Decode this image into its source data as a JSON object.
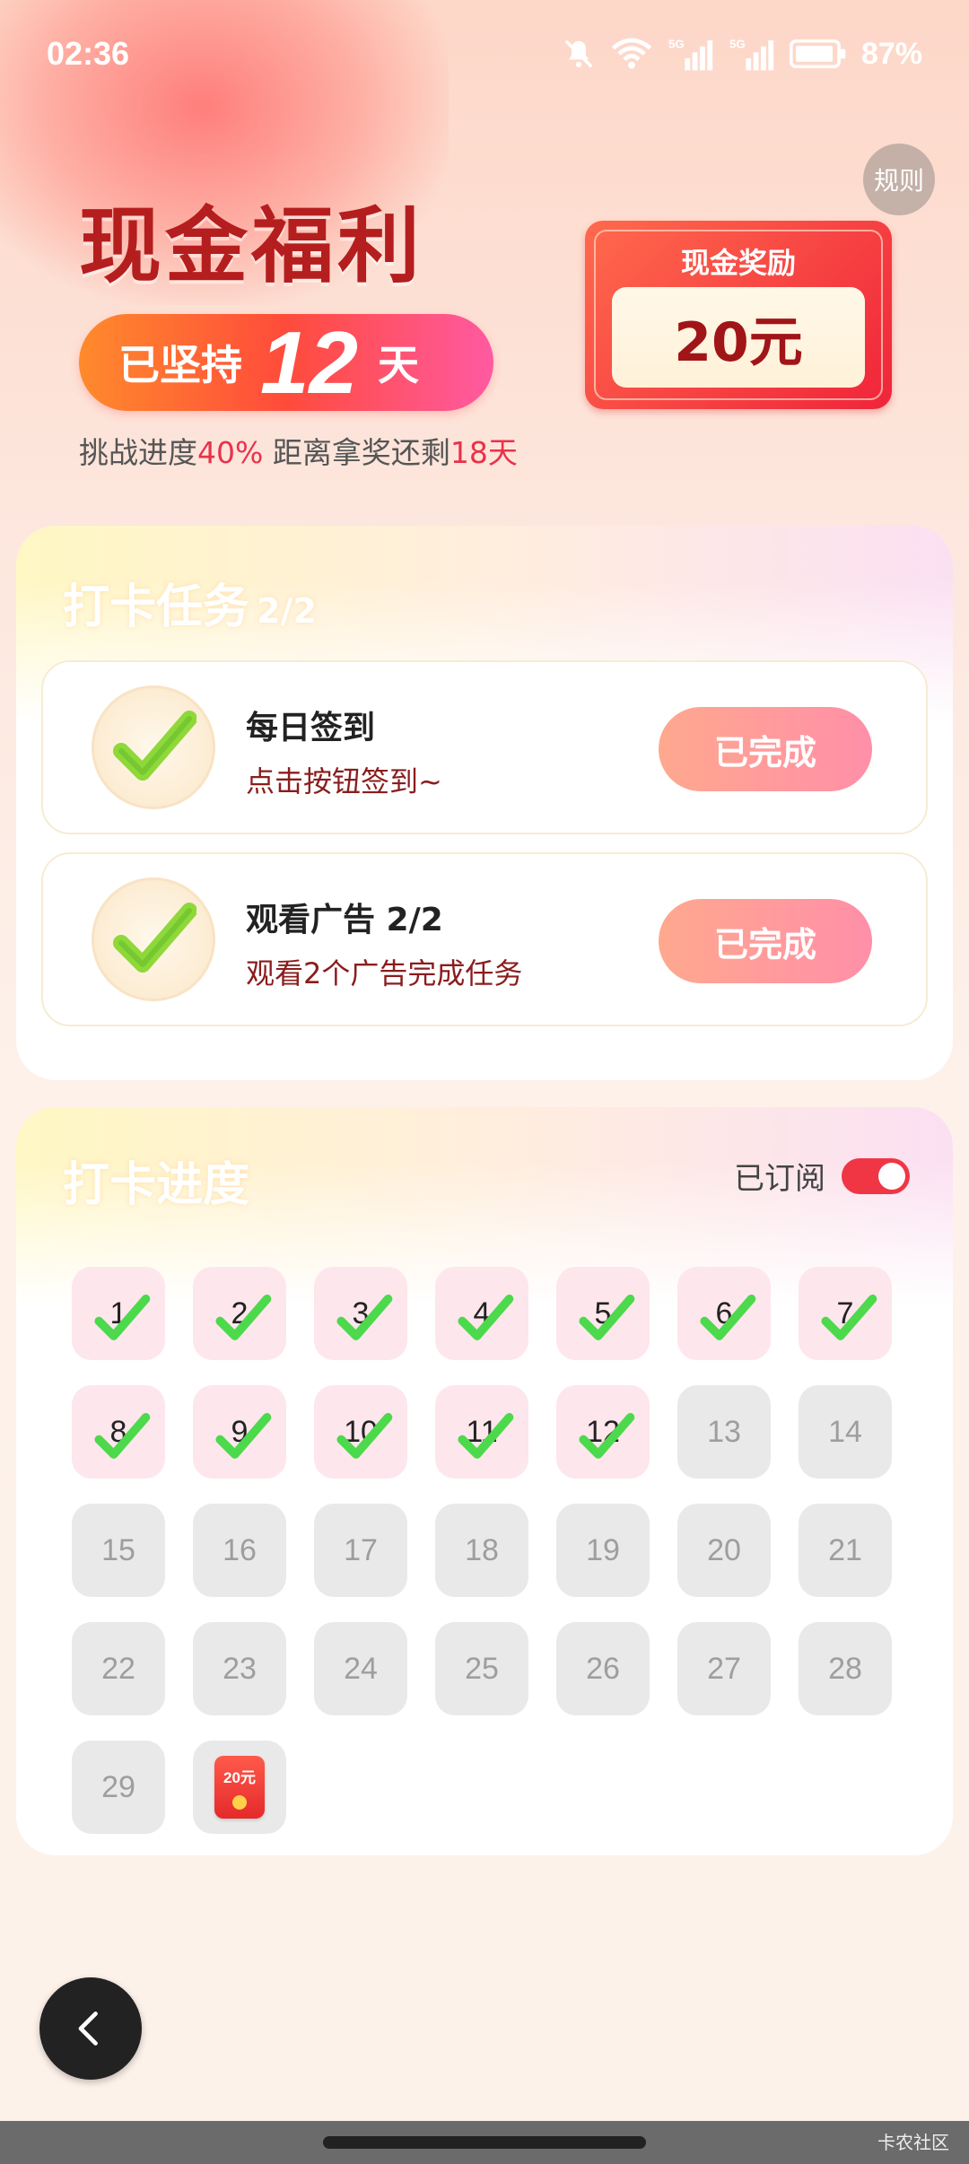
{
  "status_bar": {
    "time": "02:36",
    "battery": "87%",
    "icons": [
      "bell-mute-icon",
      "wifi-icon",
      "signal-5g-icon",
      "signal-5g-icon",
      "battery-icon"
    ]
  },
  "rules_label": "规则",
  "hero": {
    "title": "现金福利",
    "streak_prefix": "已坚持",
    "streak_days": "12",
    "streak_suffix": "天",
    "progress_prefix": "挑战进度",
    "progress_percent": "40%",
    "progress_middle": " 距离拿奖还剩",
    "remaining_days": "18天"
  },
  "reward": {
    "label": "现金奖励",
    "amount": "20元"
  },
  "tasks_card": {
    "title": "打卡任务",
    "count": "2/2",
    "tasks": [
      {
        "title": "每日签到",
        "desc": "点击按钮签到~",
        "button": "已完成"
      },
      {
        "title": "观看广告 2/2",
        "desc": "观看2个广告完成任务",
        "button": "已完成"
      }
    ]
  },
  "progress_card": {
    "title": "打卡进度",
    "subscribe_label": "已订阅",
    "subscribed": true,
    "days": [
      "1",
      "2",
      "3",
      "4",
      "5",
      "6",
      "7",
      "8",
      "9",
      "10",
      "11",
      "12",
      "13",
      "14",
      "15",
      "16",
      "17",
      "18",
      "19",
      "20",
      "21",
      "22",
      "23",
      "24",
      "25",
      "26",
      "27",
      "28",
      "29"
    ],
    "completed_days": 12,
    "final_reward_label": "20元"
  },
  "colors": {
    "accent_red": "#e8324a",
    "done_cell": "#fde6ec",
    "todo_cell": "#e9e9e9",
    "check_green": "#4cd94c"
  },
  "watermark": "卡农社区"
}
